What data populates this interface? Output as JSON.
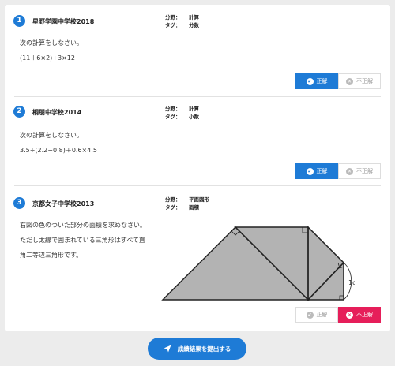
{
  "problems": [
    {
      "number": "1",
      "school": "星野学園中学校2018",
      "field_key": "分野：",
      "field_val": "計算",
      "tag_key": "タグ：",
      "tag_val": "分数",
      "lines": [
        "次の計算をしなさい。",
        "(11＋6×2)÷3×12"
      ],
      "correct_label": "正解",
      "wrong_label": "不正解",
      "selected": "correct"
    },
    {
      "number": "2",
      "school": "桐朋中学校2014",
      "field_key": "分野：",
      "field_val": "計算",
      "tag_key": "タグ：",
      "tag_val": "小数",
      "lines": [
        "次の計算をしなさい。",
        "3.5÷(2.2−0.8)＋0.6×4.5"
      ],
      "correct_label": "正解",
      "wrong_label": "不正解",
      "selected": "correct"
    },
    {
      "number": "3",
      "school": "京都女子中学校2013",
      "field_key": "分野：",
      "field_val": "平面図形",
      "tag_key": "タグ：",
      "tag_val": "面積",
      "lines": [
        "右図の色のついた部分の面積を求めなさい。",
        "ただし太線で囲まれている三角形はすべて直",
        "角二等辺三角形です。"
      ],
      "figure_label": "1cm",
      "correct_label": "正解",
      "wrong_label": "不正解",
      "selected": "wrong"
    }
  ],
  "submit_label": "成績結果を提出する",
  "colors": {
    "accent": "#1e7bd6",
    "wrong": "#e61e5a",
    "shape_fill": "#b3b3b3"
  }
}
